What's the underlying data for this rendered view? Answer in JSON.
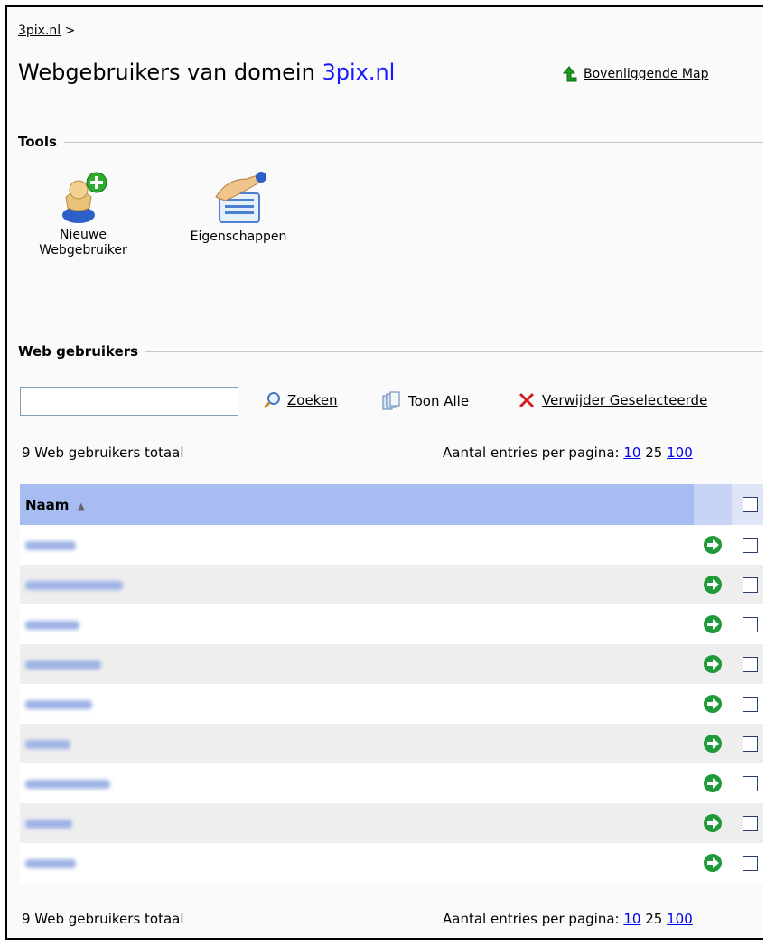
{
  "breadcrumb": {
    "link": "3pix.nl",
    "separator": ">"
  },
  "header": {
    "title_prefix": "Webgebruikers van domein",
    "domain": "3pix.nl",
    "up_folder": "Bovenliggende Map"
  },
  "tools": {
    "heading": "Tools",
    "items": [
      {
        "label_line1": "Nieuwe",
        "label_line2": "Webgebruiker"
      },
      {
        "label_line1": "Eigenschappen",
        "label_line2": ""
      }
    ]
  },
  "webusers": {
    "heading": "Web gebruikers",
    "search": {
      "value": "",
      "placeholder": ""
    },
    "actions": {
      "search": "Zoeken",
      "show_all": "Toon Alle",
      "delete_selected": "Verwijder Geselecteerde"
    },
    "total_top": "9 Web gebruikers totaal",
    "total_bottom": "9 Web gebruikers totaal",
    "per_page_label": "Aantal entries per pagina:",
    "per_page_options": [
      "10",
      "25",
      "100"
    ],
    "column_name": "Naam",
    "sort_indicator": "▲",
    "rows": [
      "",
      "",
      "",
      "",
      "",
      "",
      "",
      "",
      ""
    ]
  },
  "colors": {
    "header_blue": "#a7bcf0",
    "domain_blue": "#1a1aff",
    "row_alt": "#eeeeee"
  }
}
